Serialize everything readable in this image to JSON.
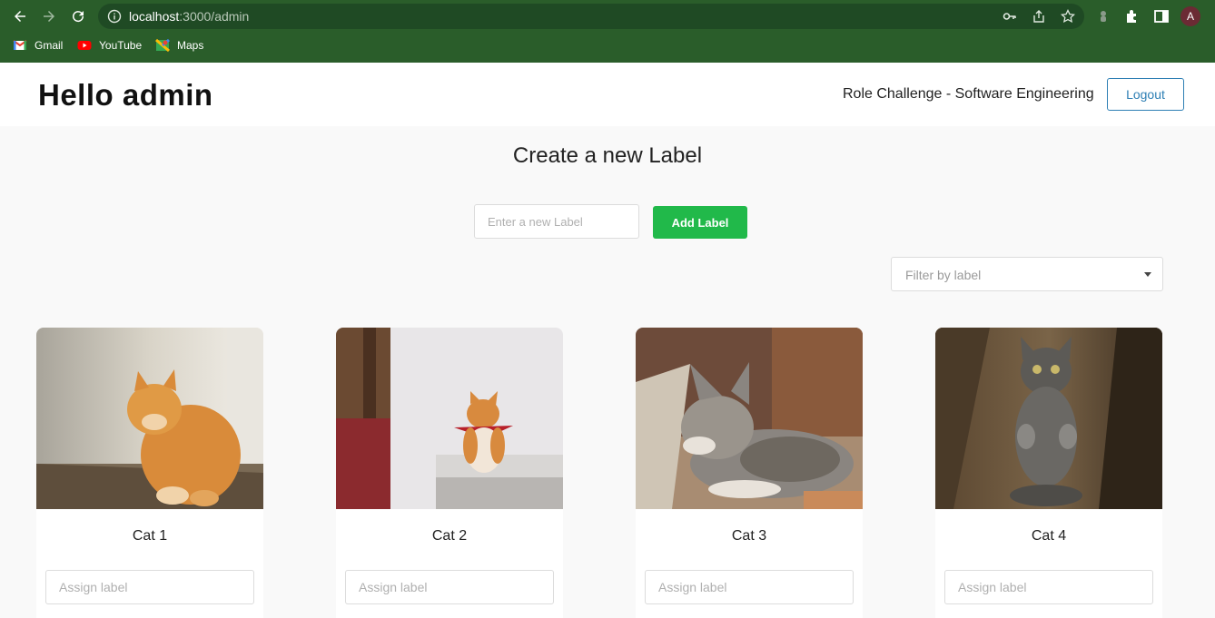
{
  "browser": {
    "url_host": "localhost",
    "url_rest": ":3000/admin",
    "profile_initial": "A",
    "bookmarks": [
      {
        "label": "Gmail",
        "icon": "gmail-icon"
      },
      {
        "label": "YouTube",
        "icon": "youtube-icon"
      },
      {
        "label": "Maps",
        "icon": "maps-icon"
      }
    ]
  },
  "header": {
    "greeting": "Hello admin",
    "role": "Role Challenge - Software Engineering",
    "logout_label": "Logout"
  },
  "create": {
    "title": "Create a new Label",
    "input_placeholder": "Enter a new Label",
    "add_button": "Add Label"
  },
  "filter": {
    "placeholder": "Filter by label"
  },
  "cards": [
    {
      "name": "Cat 1",
      "assign_placeholder": "Assign label"
    },
    {
      "name": "Cat 2",
      "assign_placeholder": "Assign label"
    },
    {
      "name": "Cat 3",
      "assign_placeholder": "Assign label"
    },
    {
      "name": "Cat 4",
      "assign_placeholder": "Assign label"
    }
  ],
  "colors": {
    "browser_bar": "#2a5d2a",
    "add_button": "#21b94a",
    "logout_border": "#2d7fb4"
  }
}
